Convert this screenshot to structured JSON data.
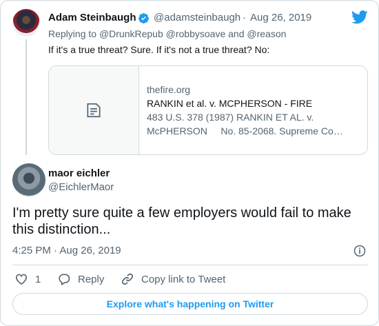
{
  "parent_tweet": {
    "author_name": "Adam Steinbaugh",
    "author_handle": "@adamsteinbaugh",
    "separator": "·",
    "date": "Aug 26, 2019",
    "replying_prefix": "Replying to",
    "replying_handles": [
      "@DrunkRepub",
      "@robbysoave",
      "@reason"
    ],
    "replying_and": "and",
    "text": "If it's a true threat? Sure. If it's not a true threat? No:",
    "link_card": {
      "domain": "thefire.org",
      "title": "RANKIN et al. v. MCPHERSON - FIRE",
      "description_line1": "483 U.S. 378 (1987) RANKIN ET AL. v.",
      "description_line2": "McPHERSON     No. 85-2068. Supreme Co…",
      "icon": "document-icon"
    }
  },
  "main_tweet": {
    "author_name": "maor eichler",
    "author_handle": "@EichlerMaor",
    "text": "I'm pretty sure quite a few employers would fail to make this distinction...",
    "time": "4:25 PM",
    "separator": "·",
    "date": "Aug 26, 2019"
  },
  "actions": {
    "like_count": "1",
    "reply_label": "Reply",
    "copy_label": "Copy link to Tweet"
  },
  "explore_button": "Explore what's happening on Twitter",
  "colors": {
    "accent": "#1d9bf0",
    "text": "#0f1419",
    "secondary": "#536471",
    "border": "#cfd9de"
  }
}
